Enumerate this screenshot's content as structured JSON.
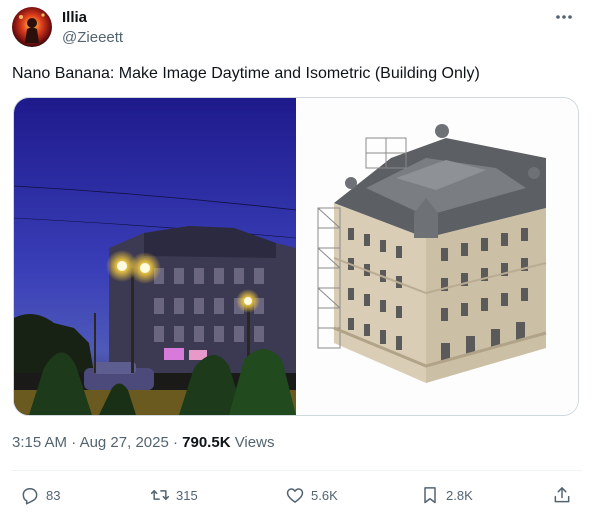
{
  "author": {
    "name": "Illia",
    "handle": "@Zieeett"
  },
  "tweet": {
    "text": "Nano Banana: Make Image Daytime and Isometric (Building Only)"
  },
  "meta": {
    "time": "3:15 AM",
    "date": "Aug 27, 2025",
    "views_count": "790.5K",
    "views_label": "Views"
  },
  "actions": {
    "replies": "83",
    "retweets": "315",
    "likes": "5.6K",
    "bookmarks": "2.8K"
  },
  "colors": {
    "text_primary": "#0f1419",
    "text_secondary": "#536471",
    "border": "#cfd9de"
  },
  "icons": [
    "more-icon",
    "reply-icon",
    "retweet-icon",
    "like-icon",
    "bookmark-icon",
    "share-icon"
  ]
}
